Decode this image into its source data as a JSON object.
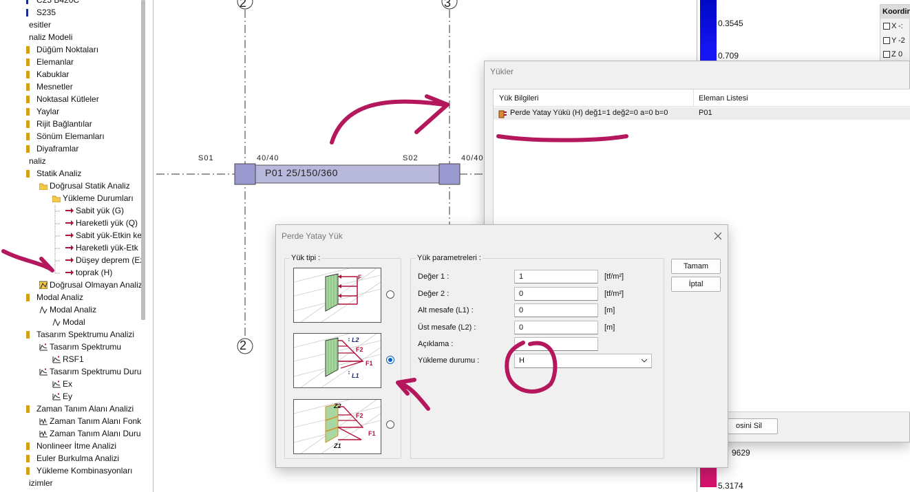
{
  "tree": [
    {
      "label": "C25 B420C",
      "indent": 53,
      "icon": "material-icon"
    },
    {
      "label": "S235",
      "indent": 53,
      "icon": "material-icon"
    },
    {
      "label": "esitler",
      "indent": 42,
      "icon": ""
    },
    {
      "label": "naliz Modeli",
      "indent": 42,
      "icon": ""
    },
    {
      "label": "Düğüm Noktaları",
      "indent": 53,
      "icon": "folder-icon"
    },
    {
      "label": "Elemanlar",
      "indent": 53,
      "icon": "folder-icon"
    },
    {
      "label": "Kabuklar",
      "indent": 53,
      "icon": "folder-icon"
    },
    {
      "label": "Mesnetler",
      "indent": 53,
      "icon": "folder-icon"
    },
    {
      "label": "Noktasal Kütleler",
      "indent": 53,
      "icon": "folder-icon"
    },
    {
      "label": "Yaylar",
      "indent": 53,
      "icon": "folder-icon"
    },
    {
      "label": "Rijit Bağlantılar",
      "indent": 53,
      "icon": "folder-icon"
    },
    {
      "label": "Sönüm Elemanları",
      "indent": 53,
      "icon": "folder-icon"
    },
    {
      "label": "Diyaframlar",
      "indent": 53,
      "icon": "folder-icon"
    },
    {
      "label": "naliz",
      "indent": 42,
      "icon": ""
    },
    {
      "label": "Statik Analiz",
      "indent": 53,
      "icon": "folder-icon"
    },
    {
      "label": "Doğrusal Statik Analiz",
      "indent": 72,
      "icon": "open-folder-icon"
    },
    {
      "label": "Yükleme Durumları",
      "indent": 91,
      "icon": "open-folder-icon"
    },
    {
      "label": "Sabit yük (G)",
      "indent": 110,
      "icon": "load-arrow-icon"
    },
    {
      "label": "Hareketli yük (Q)",
      "indent": 110,
      "icon": "load-arrow-icon"
    },
    {
      "label": "Sabit yük-Etkin ke",
      "indent": 110,
      "icon": "load-arrow-icon"
    },
    {
      "label": "Hareketli yük-Etk",
      "indent": 110,
      "icon": "load-arrow-icon"
    },
    {
      "label": "Düşey deprem (Ez",
      "indent": 110,
      "icon": "load-arrow-icon"
    },
    {
      "label": "toprak (H)",
      "indent": 110,
      "icon": "load-arrow-icon"
    },
    {
      "label": "Doğrusal Olmayan Analiz",
      "indent": 72,
      "icon": "nonlinear-icon"
    },
    {
      "label": "Modal Analiz",
      "indent": 53,
      "icon": "folder-icon"
    },
    {
      "label": "Modal Analiz",
      "indent": 72,
      "icon": "modal-icon"
    },
    {
      "label": "Modal",
      "indent": 91,
      "icon": "modal-icon"
    },
    {
      "label": "Tasarım Spektrumu Analizi",
      "indent": 53,
      "icon": "folder-icon"
    },
    {
      "label": "Tasarım Spektrumu",
      "indent": 72,
      "icon": "spectrum-icon"
    },
    {
      "label": "RSF1",
      "indent": 91,
      "icon": "spectrum-icon"
    },
    {
      "label": "Tasarım Spektrumu Duru",
      "indent": 72,
      "icon": "spectrum-icon"
    },
    {
      "label": "Ex",
      "indent": 91,
      "icon": "spectrum-icon"
    },
    {
      "label": "Ey",
      "indent": 91,
      "icon": "spectrum-icon"
    },
    {
      "label": "Zaman Tanım Alanı Analizi",
      "indent": 53,
      "icon": "folder-icon"
    },
    {
      "label": "Zaman Tanım Alanı Fonk",
      "indent": 72,
      "icon": "time-history-icon"
    },
    {
      "label": "Zaman Tanım Alanı Duru",
      "indent": 72,
      "icon": "time-history-icon"
    },
    {
      "label": "Nonlineer İtme Analizi",
      "indent": 53,
      "icon": "folder-icon"
    },
    {
      "label": "Euler Burkulma Analizi",
      "indent": 53,
      "icon": "folder-icon"
    },
    {
      "label": "Yükleme Kombinasyonları",
      "indent": 53,
      "icon": "folder-icon"
    },
    {
      "label": "izimler",
      "indent": 42,
      "icon": ""
    }
  ],
  "canvas": {
    "axis_2_top": "2",
    "axis_3_top": "3",
    "axis_2_bottom": "2",
    "s01": "S01",
    "s01_size": "40/40",
    "s02": "S02",
    "s02_size": "40/40",
    "wall_label": "P01 25/150/360"
  },
  "colorscale": {
    "v1": "0.3545",
    "v2": "0.709",
    "v3": "9629",
    "v4": "5.3174"
  },
  "coords": {
    "title": "Koordin",
    "x": "X",
    "y": "Y",
    "z": "Z",
    "xv": "-:",
    "yv": "-2",
    "zv": "0"
  },
  "yukler": {
    "title": "Yükler",
    "col1": "Yük Bilgileri",
    "col2": "Eleman Listesi",
    "row_load": "Perde Yatay Yükü (H) değ1=1 değ2=0 a=0 b=0",
    "row_elem": "P01",
    "delete_btn": "osini Sil"
  },
  "dialog": {
    "title": "Perde Yatay Yük",
    "type_group": "Yük tipi :",
    "param_group": "Yük parametreleri :",
    "deger1": "Değer 1 :",
    "deger1_val": "1",
    "deger1_unit": "[tf/m²]",
    "deger2": "Değer 2 :",
    "deger2_val": "0",
    "deger2_unit": "[tf/m²]",
    "alt": "Alt mesafe (L1) :",
    "alt_val": "0",
    "alt_unit": "[m]",
    "ust": "Üst mesafe (L2) :",
    "ust_val": "0",
    "ust_unit": "[m]",
    "aciklama": "Açıklama :",
    "aciklama_val": "",
    "yukleme": "Yükleme durumu :",
    "yukleme_val": "H",
    "ok": "Tamam",
    "cancel": "İptal",
    "img1_f": "F",
    "img2_l2": "L2",
    "img2_f2": "F2",
    "img2_f1": "F1",
    "img2_l1": "L1",
    "img3_z2": "Z2",
    "img3_f2": "F2",
    "img3_f1": "F1",
    "img3_z1": "Z1",
    "selected_type": 2
  },
  "colors": {
    "annotation": "#b5175d",
    "load": "#b0103a",
    "accent": "#0a5fc4"
  }
}
